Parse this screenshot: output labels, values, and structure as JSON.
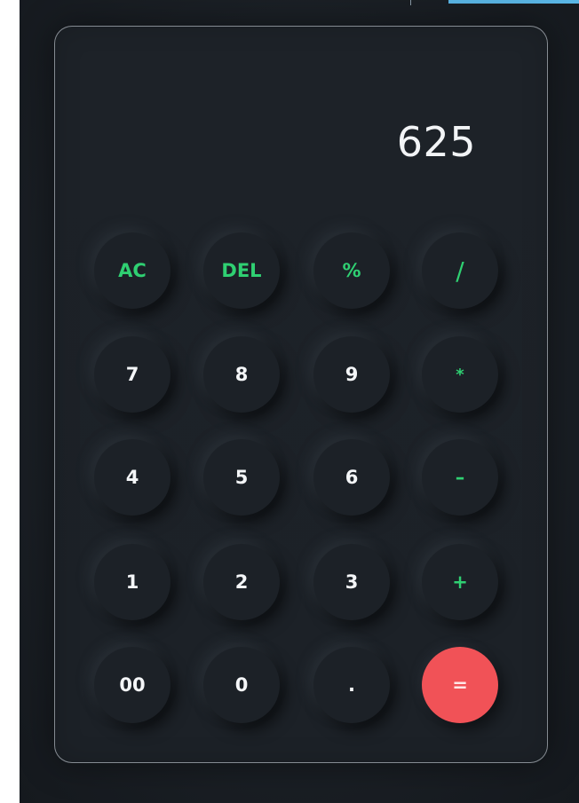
{
  "display": {
    "value": "625"
  },
  "keys": {
    "ac": "AC",
    "del": "DEL",
    "percent": "%",
    "divide": "/",
    "seven": "7",
    "eight": "8",
    "nine": "9",
    "multiply": "*",
    "four": "4",
    "five": "5",
    "six": "6",
    "minus": "–",
    "one": "1",
    "two": "2",
    "three": "3",
    "plus": "+",
    "double_zero": "00",
    "zero": "0",
    "decimal": ".",
    "equals": "="
  },
  "colors": {
    "background": "#1c2127",
    "function_key": "#2fd072",
    "equals_key": "#f15257",
    "digit_text": "#f4f6f8"
  }
}
